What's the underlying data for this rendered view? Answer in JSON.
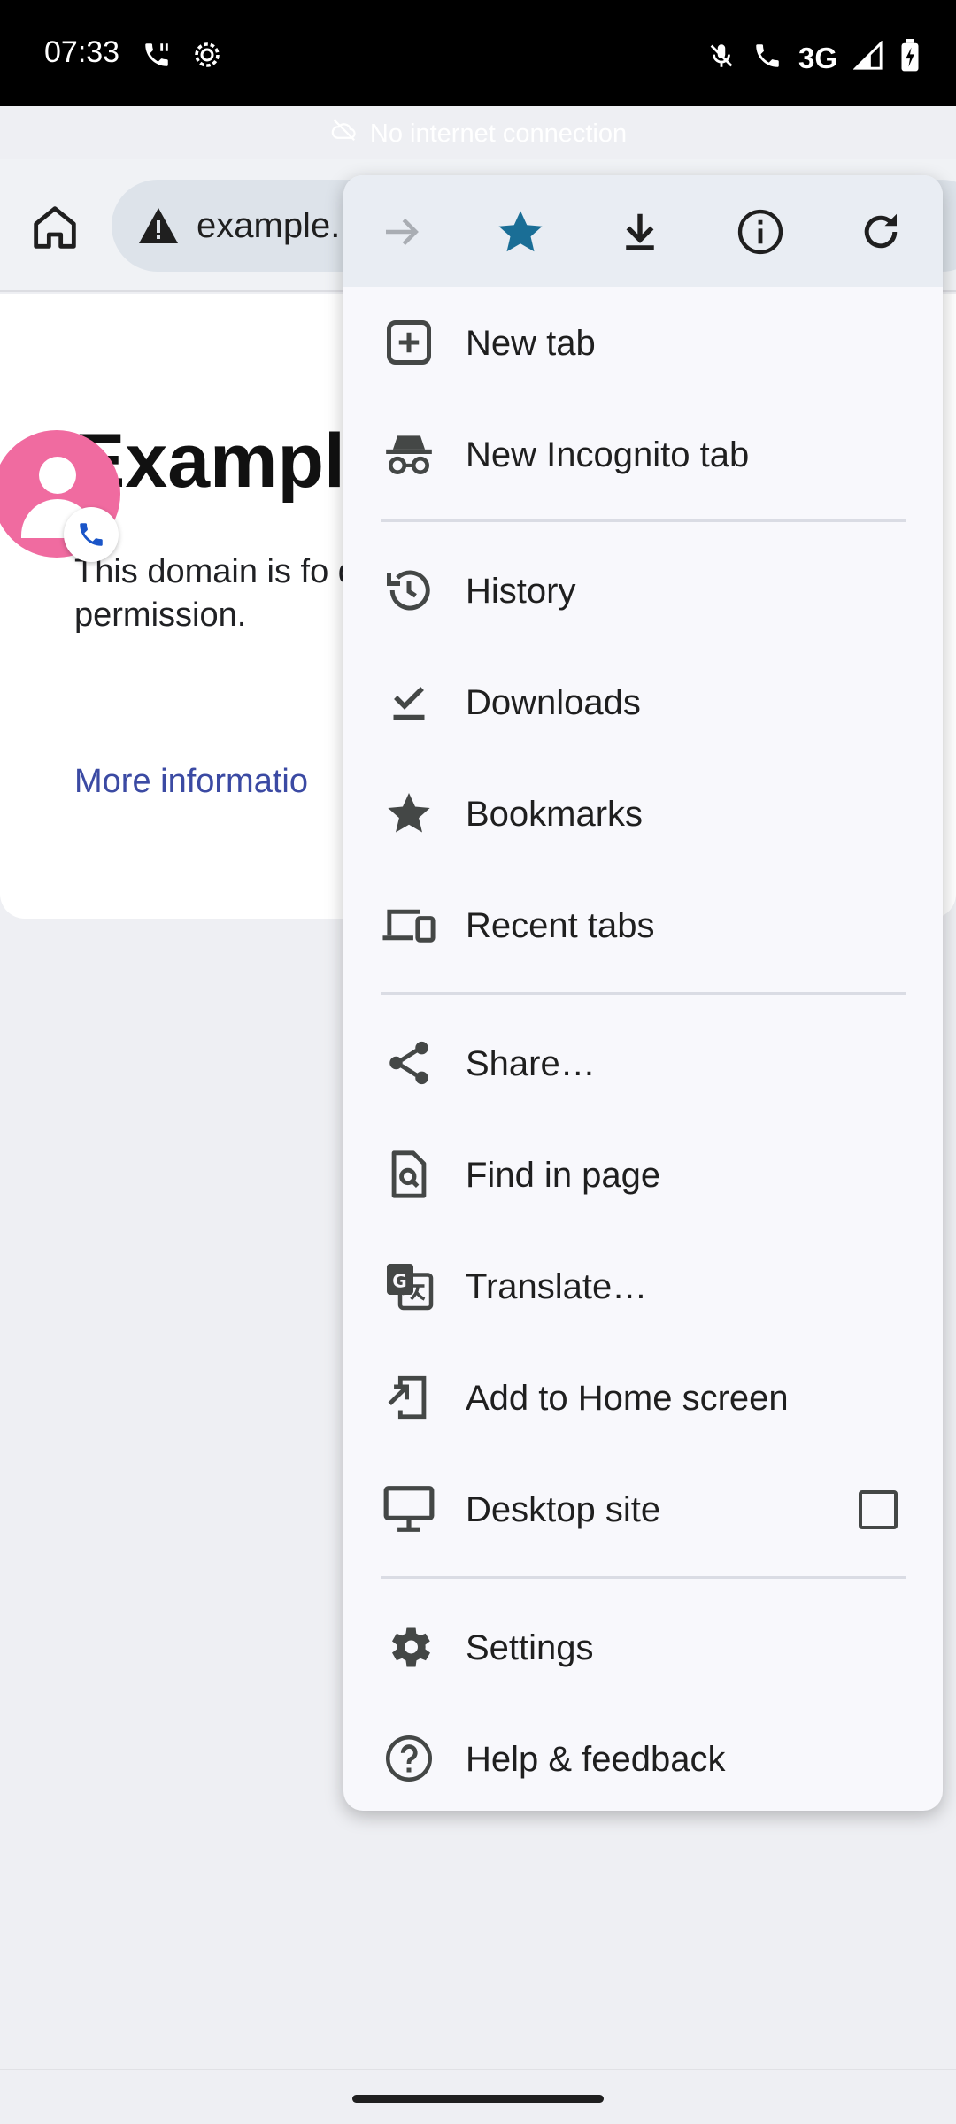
{
  "status_bar": {
    "time": "07:33",
    "network": "3G",
    "offline_banner": "No internet connection"
  },
  "toolbar": {
    "url": "example."
  },
  "page": {
    "heading": "Example",
    "body": "This domain is fo documents. You literature withou permission.",
    "link": "More informatio"
  },
  "menu": {
    "top_icons": [
      "forward-icon",
      "bookmark-star-icon",
      "download-icon",
      "info-icon",
      "refresh-icon"
    ],
    "items": [
      {
        "label": "New tab",
        "icon": "new-tab-icon"
      },
      {
        "label": "New Incognito tab",
        "icon": "incognito-icon"
      },
      {
        "label": "History",
        "icon": "history-icon"
      },
      {
        "label": "Downloads",
        "icon": "downloads-icon"
      },
      {
        "label": "Bookmarks",
        "icon": "bookmarks-icon"
      },
      {
        "label": "Recent tabs",
        "icon": "recent-tabs-icon"
      },
      {
        "label": "Share…",
        "icon": "share-icon"
      },
      {
        "label": "Find in page",
        "icon": "find-in-page-icon"
      },
      {
        "label": "Translate…",
        "icon": "translate-icon"
      },
      {
        "label": "Add to Home screen",
        "icon": "add-to-home-icon"
      },
      {
        "label": "Desktop site",
        "icon": "desktop-icon",
        "checked": false
      },
      {
        "label": "Settings",
        "icon": "settings-icon"
      },
      {
        "label": "Help & feedback",
        "icon": "help-icon"
      }
    ]
  },
  "colors": {
    "accent": "#1a6e96",
    "bubble": "#f06ba0",
    "link": "#3b4aa3"
  }
}
